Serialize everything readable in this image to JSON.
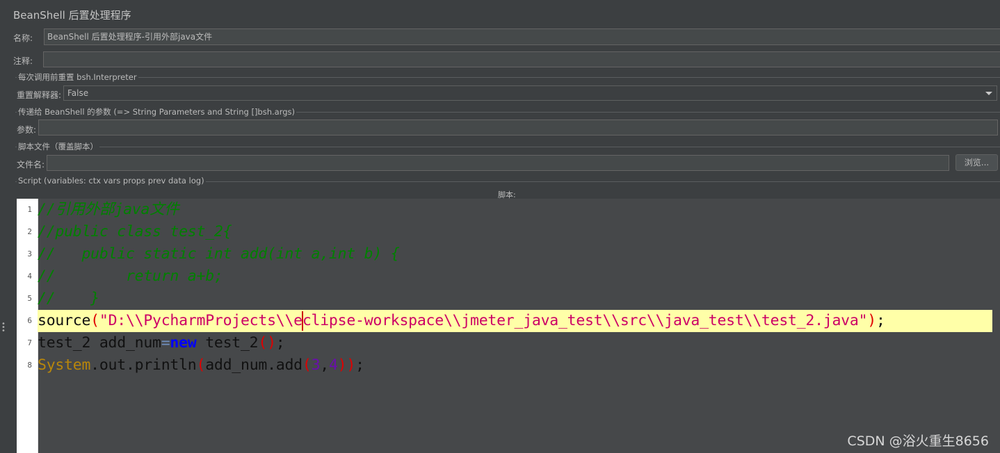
{
  "panel": {
    "title": "BeanShell 后置处理程序"
  },
  "name_field": {
    "label": "名称:",
    "value": "BeanShell 后置处理程序-引用外部java文件"
  },
  "comment_field": {
    "label": "注释:",
    "value": ""
  },
  "reset_section": {
    "legend": "每次调用前重置 bsh.Interpreter",
    "label": "重置解释器:",
    "selected": "False"
  },
  "params_section": {
    "legend": "传递给 BeanShell 的参数 (=> String Parameters and String []bsh.args)",
    "label": "参数:",
    "value": ""
  },
  "script_file_section": {
    "legend": "脚本文件（覆盖脚本）",
    "label": "文件名:",
    "value": "",
    "browse_button": "浏览..."
  },
  "script_section": {
    "legend": "Script (variables: ctx vars props prev data log)",
    "editor_label": "脚本:",
    "highlighted_line": 6,
    "lines": [
      {
        "n": "1",
        "tokens": [
          {
            "t": "//引用外部java文件",
            "c": "c-comment"
          }
        ]
      },
      {
        "n": "2",
        "tokens": [
          {
            "t": "//public class test_2{",
            "c": "c-comment"
          }
        ]
      },
      {
        "n": "3",
        "tokens": [
          {
            "t": "//   public static int add(int a,int b) {",
            "c": "c-comment"
          }
        ]
      },
      {
        "n": "4",
        "tokens": [
          {
            "t": "//        return a+b;",
            "c": "c-comment"
          }
        ]
      },
      {
        "n": "5",
        "tokens": [
          {
            "t": "//    }",
            "c": "c-comment"
          }
        ]
      },
      {
        "n": "6",
        "tokens": [
          {
            "t": "source",
            "c": ""
          },
          {
            "t": "(",
            "c": "c-paren"
          },
          {
            "t": "\"D:\\\\PycharmProjects\\\\e",
            "c": "c-str"
          },
          {
            "t": "|",
            "c": "cursor"
          },
          {
            "t": "clipse-workspace\\\\jmeter_java_test\\\\src\\\\java_test\\\\test_2.java\"",
            "c": "c-str"
          },
          {
            "t": ")",
            "c": "c-paren"
          },
          {
            "t": ";",
            "c": ""
          }
        ]
      },
      {
        "n": "7",
        "tokens": [
          {
            "t": "test_2 add_num",
            "c": ""
          },
          {
            "t": "=",
            "c": "c-op"
          },
          {
            "t": "new",
            "c": "c-kw"
          },
          {
            "t": " test_2",
            "c": ""
          },
          {
            "t": "()",
            "c": "c-paren"
          },
          {
            "t": ";",
            "c": ""
          }
        ]
      },
      {
        "n": "8",
        "tokens": [
          {
            "t": "System",
            "c": "c-sys"
          },
          {
            "t": ".out.println",
            "c": ""
          },
          {
            "t": "(",
            "c": "c-paren"
          },
          {
            "t": "add_num.add",
            "c": ""
          },
          {
            "t": "(",
            "c": "c-paren"
          },
          {
            "t": "3",
            "c": "c-num"
          },
          {
            "t": ",",
            "c": ""
          },
          {
            "t": "4",
            "c": "c-num"
          },
          {
            "t": "))",
            "c": "c-paren"
          },
          {
            "t": ";",
            "c": ""
          }
        ]
      }
    ]
  },
  "watermark": "CSDN @浴火重生8656",
  "colors": {
    "background": "#3c3f41",
    "editor_background": "#46484a",
    "highlight_line": "#ffffa8",
    "comment": "#008000",
    "string": "#cc0066",
    "keyword": "#0000ff"
  }
}
